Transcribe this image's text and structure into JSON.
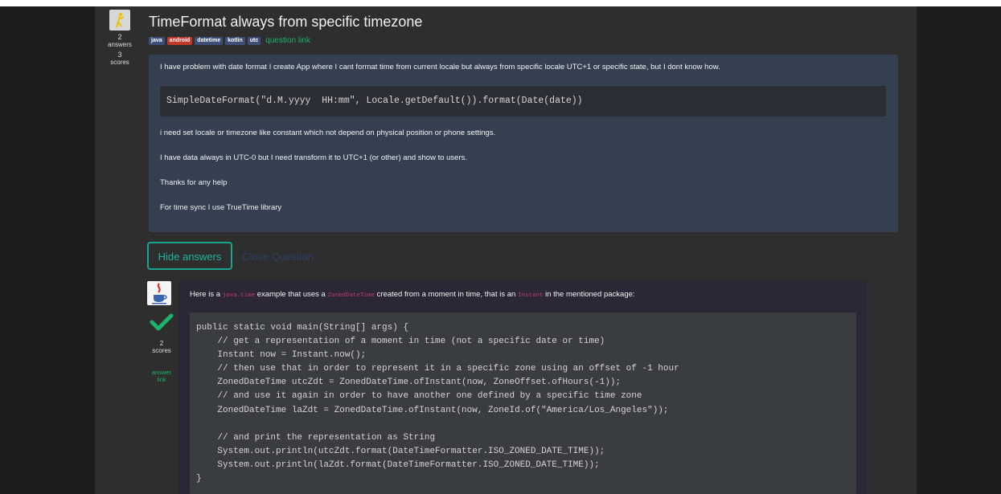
{
  "question": {
    "title": "TimeFormat always from specific timezone",
    "answers_count": "2",
    "answers_label": "answers",
    "scores_count": "3",
    "scores_label": "scores",
    "tags": [
      "java",
      "android",
      "datetime",
      "kotlin",
      "utc"
    ],
    "link_label": "question link",
    "body": {
      "p1": "I have problem with date format I create App where I cant format time from current locale but always from specific locale UTC+1 or specific state, but I dont know how.",
      "code": "SimpleDateFormat(\"d.M.yyyy  HH:mm\", Locale.getDefault()).format(Date(date))",
      "p2": "i need set locale or timezone like constant which not depend on physical position or phone settings.",
      "p3": "I have data always in UTC-0 but I need transform it to UTC+1 (or other) and show to users.",
      "p4": "Thanks for any help",
      "p5": "For time sync I use TrueTime library"
    }
  },
  "actions": {
    "hide_answers": "Hide answers",
    "close_question": "Close Question"
  },
  "answer": {
    "scores_count": "2",
    "scores_label": "scores",
    "link_label_1": "answer",
    "link_label_2": "link",
    "intro": {
      "t1": "Here is a ",
      "c1": "java.time",
      "t2": " example that uses a ",
      "c2": "ZonedDateTime",
      "t3": " created from a moment in time, that is an ",
      "c3": "Instant",
      "t4": " in the mentioned package:"
    },
    "code": "public static void main(String[] args) {\n    // get a representation of a moment in time (not a specific date or time)\n    Instant now = Instant.now();\n    // then use that in order to represent it in a specific zone using an offset of -1 hour\n    ZonedDateTime utcZdt = ZonedDateTime.ofInstant(now, ZoneOffset.ofHours(-1));\n    // and use it again in order to have another one defined by a specific time zone\n    ZonedDateTime laZdt = ZonedDateTime.ofInstant(now, ZoneId.of(\"America/Los_Angeles\"));\n\n    // and print the representation as String\n    System.out.println(utcZdt.format(DateTimeFormatter.ISO_ZONED_DATE_TIME));\n    System.out.println(laZdt.format(DateTimeFormatter.ISO_ZONED_DATE_TIME));\n}"
  },
  "icons": {
    "question_avatar": "user-avatar-icon",
    "answer_avatar": "java-logo-icon",
    "accepted": "checkmark-icon"
  },
  "colors": {
    "accent_green": "#1db36a",
    "tag_blue": "#3d4f79",
    "tag_red": "#c0392b",
    "question_bg": "#34404f",
    "answer_bg": "#2b2736"
  }
}
